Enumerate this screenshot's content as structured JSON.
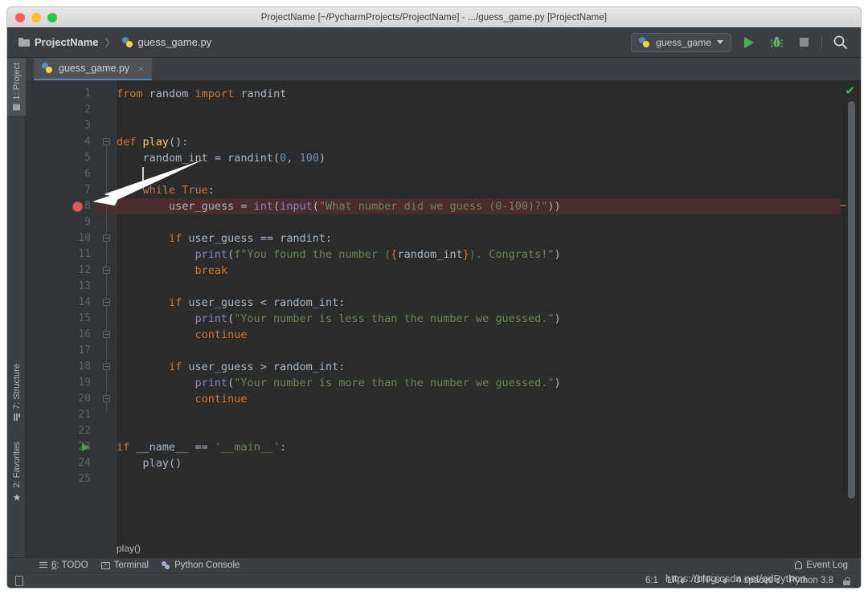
{
  "window": {
    "title": "ProjectName [~/PycharmProjects/ProjectName] - .../guess_game.py [ProjectName]",
    "traffic_lights": [
      "close-red",
      "minimize-yellow",
      "maximize-green"
    ]
  },
  "navbar": {
    "breadcrumbs": [
      {
        "label": "ProjectName",
        "icon": "folder-icon"
      },
      {
        "label": "guess_game.py",
        "icon": "python-file-icon"
      }
    ],
    "separator": "〉",
    "run_config": {
      "label": "guess_game",
      "icon": "python-icon",
      "caret": "chevron-down-icon"
    },
    "buttons": [
      {
        "name": "run-button",
        "icon": "play-triangle-icon"
      },
      {
        "name": "debug-button",
        "icon": "bug-icon"
      },
      {
        "name": "stop-button",
        "icon": "stop-square-icon"
      },
      {
        "name": "search-button",
        "icon": "search-icon"
      }
    ]
  },
  "left_stripe": [
    {
      "label": "1: Project",
      "icon": "folder-icon",
      "active": true
    },
    {
      "label": "7: Structure",
      "icon": "structure-icon",
      "active": false
    },
    {
      "label": "2: Favorites",
      "icon": "star-icon",
      "active": false
    }
  ],
  "editor_tabs": [
    {
      "label": "guess_game.py",
      "icon": "python-file-icon",
      "close": "×",
      "active": true
    }
  ],
  "editor": {
    "first_line": 1,
    "last_line": 25,
    "breakpoint_line": 8,
    "run_marker_line": 23,
    "caret_line": 6,
    "inspection_status": "✔",
    "breadcrumb": "play()",
    "fold_marker_lines": [
      4,
      10,
      12,
      14,
      16,
      18,
      20
    ],
    "code_lines": [
      {
        "n": 1,
        "indent": 0,
        "tokens": [
          {
            "t": "from",
            "c": "kw"
          },
          {
            "t": " random ",
            "c": "id"
          },
          {
            "t": "import",
            "c": "kw"
          },
          {
            "t": " randint",
            "c": "id"
          }
        ]
      },
      {
        "n": 2,
        "indent": 0,
        "tokens": []
      },
      {
        "n": 3,
        "indent": 0,
        "tokens": []
      },
      {
        "n": 4,
        "indent": 0,
        "tokens": [
          {
            "t": "def ",
            "c": "kw"
          },
          {
            "t": "play",
            "c": "fn"
          },
          {
            "t": "():",
            "c": "id"
          }
        ]
      },
      {
        "n": 5,
        "indent": 1,
        "tokens": [
          {
            "t": "random_int = randint(",
            "c": "id"
          },
          {
            "t": "0",
            "c": "num"
          },
          {
            "t": ", ",
            "c": "id"
          },
          {
            "t": "100",
            "c": "num"
          },
          {
            "t": ")",
            "c": "id"
          }
        ]
      },
      {
        "n": 6,
        "indent": 1,
        "tokens": []
      },
      {
        "n": 7,
        "indent": 1,
        "tokens": [
          {
            "t": "while ",
            "c": "kw"
          },
          {
            "t": "True",
            "c": "kw"
          },
          {
            "t": ":",
            "c": "id"
          }
        ]
      },
      {
        "n": 8,
        "indent": 2,
        "tokens": [
          {
            "t": "user_guess = ",
            "c": "id"
          },
          {
            "t": "int",
            "c": "builtin"
          },
          {
            "t": "(",
            "c": "id"
          },
          {
            "t": "input",
            "c": "builtin"
          },
          {
            "t": "(",
            "c": "id"
          },
          {
            "t": "\"What number did we guess (0-100)?\"",
            "c": "str"
          },
          {
            "t": "))",
            "c": "id"
          }
        ]
      },
      {
        "n": 9,
        "indent": 0,
        "tokens": []
      },
      {
        "n": 10,
        "indent": 2,
        "tokens": [
          {
            "t": "if ",
            "c": "kw"
          },
          {
            "t": "user_guess == randint:",
            "c": "id"
          }
        ]
      },
      {
        "n": 11,
        "indent": 3,
        "tokens": [
          {
            "t": "print",
            "c": "builtin"
          },
          {
            "t": "(",
            "c": "id"
          },
          {
            "t": "f\"You found the number (",
            "c": "str"
          },
          {
            "t": "{",
            "c": "fsub"
          },
          {
            "t": "random_int",
            "c": "id"
          },
          {
            "t": "}",
            "c": "fsub"
          },
          {
            "t": "). Congrats!\"",
            "c": "str"
          },
          {
            "t": ")",
            "c": "id"
          }
        ]
      },
      {
        "n": 12,
        "indent": 3,
        "tokens": [
          {
            "t": "break",
            "c": "kw"
          }
        ]
      },
      {
        "n": 13,
        "indent": 0,
        "tokens": []
      },
      {
        "n": 14,
        "indent": 2,
        "tokens": [
          {
            "t": "if ",
            "c": "kw"
          },
          {
            "t": "user_guess < random_int:",
            "c": "id"
          }
        ]
      },
      {
        "n": 15,
        "indent": 3,
        "tokens": [
          {
            "t": "print",
            "c": "builtin"
          },
          {
            "t": "(",
            "c": "id"
          },
          {
            "t": "\"Your number is less than the number we guessed.\"",
            "c": "str"
          },
          {
            "t": ")",
            "c": "id"
          }
        ]
      },
      {
        "n": 16,
        "indent": 3,
        "tokens": [
          {
            "t": "continue",
            "c": "kw"
          }
        ]
      },
      {
        "n": 17,
        "indent": 0,
        "tokens": []
      },
      {
        "n": 18,
        "indent": 2,
        "tokens": [
          {
            "t": "if ",
            "c": "kw"
          },
          {
            "t": "user_guess > random_int:",
            "c": "id"
          }
        ]
      },
      {
        "n": 19,
        "indent": 3,
        "tokens": [
          {
            "t": "print",
            "c": "builtin"
          },
          {
            "t": "(",
            "c": "id"
          },
          {
            "t": "\"Your number is more than the number we guessed.\"",
            "c": "str"
          },
          {
            "t": ")",
            "c": "id"
          }
        ]
      },
      {
        "n": 20,
        "indent": 3,
        "tokens": [
          {
            "t": "continue",
            "c": "kw"
          }
        ]
      },
      {
        "n": 21,
        "indent": 0,
        "tokens": []
      },
      {
        "n": 22,
        "indent": 0,
        "tokens": []
      },
      {
        "n": 23,
        "indent": 0,
        "tokens": [
          {
            "t": "if ",
            "c": "kw"
          },
          {
            "t": "__name__",
            "c": "id"
          },
          {
            "t": " == ",
            "c": "id"
          },
          {
            "t": "'__main__'",
            "c": "str"
          },
          {
            "t": ":",
            "c": "id"
          }
        ]
      },
      {
        "n": 24,
        "indent": 1,
        "tokens": [
          {
            "t": "play()",
            "c": "id"
          }
        ]
      },
      {
        "n": 25,
        "indent": 0,
        "tokens": []
      }
    ]
  },
  "bottom_bar": {
    "items": [
      {
        "label": "6: TODO",
        "shortcut": "6",
        "icon": "todo-list-icon"
      },
      {
        "label": "Terminal",
        "icon": "terminal-icon"
      },
      {
        "label": "Python Console",
        "icon": "python-icon"
      }
    ],
    "event_log": {
      "label": "Event Log",
      "icon": "bell-icon"
    }
  },
  "status_bar": {
    "widget_icon": "tool-window-icon",
    "caret_position": "6:1",
    "line_separator": "LF",
    "encoding": "UTF-8",
    "indent": "4 spaces",
    "interpreter": "Python 3.8",
    "lock_icon": "lock-icon"
  },
  "watermark": "https://blog.csdn.net/qdPython",
  "colors": {
    "editor_bg": "#2b2b2b",
    "gutter_bg": "#313335",
    "chrome_bg": "#3c3f41",
    "keyword": "#cc7832",
    "string": "#6a8759",
    "number": "#6897bb",
    "function": "#ffc66d",
    "builtin": "#8888c6",
    "identifier": "#a9b7c6",
    "breakpoint": "#db5c5c",
    "breakpoint_row": "#4b2b2d",
    "run_green": "#4caf50",
    "tab_underline": "#4a88c7"
  }
}
